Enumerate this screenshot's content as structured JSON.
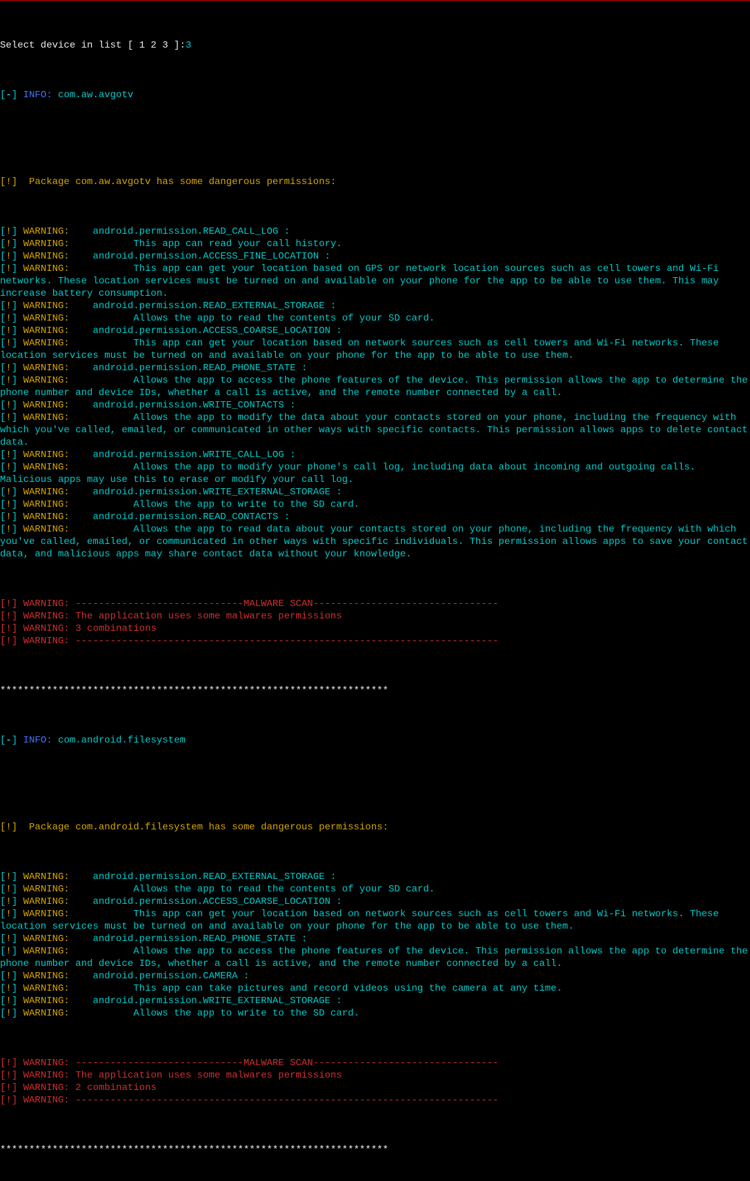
{
  "prompt_line": {
    "text": "Select device in list [ 1 2 3 ]:",
    "input": "3"
  },
  "info_prefix_open": "[",
  "info_prefix_dash": "-",
  "info_prefix_close": "] ",
  "info_label": "INFO:",
  "warn_prefix_open": "[",
  "warn_prefix_bang": "!",
  "warn_prefix_close": "] ",
  "warn_label": "WARNING:",
  "section_header_prefix": "[!]  ",
  "asterisks": "*******************************************************************",
  "pkg1": {
    "name": " com.aw.avgotv",
    "header": "Package com.aw.avgotv has some dangerous permissions: ",
    "warnings": [
      "   android.permission.READ_CALL_LOG :",
      "          This app can read your call history.",
      "   android.permission.ACCESS_FINE_LOCATION :",
      "          This app can get your location based on GPS or network location sources such as cell towers and Wi-Fi networks. These location services must be turned on and available on your phone for the app to be able to use them. This may increase battery consumption.",
      "   android.permission.READ_EXTERNAL_STORAGE :",
      "          Allows the app to read the contents of your SD card.",
      "   android.permission.ACCESS_COARSE_LOCATION :",
      "          This app can get your location based on network sources such as cell towers and Wi-Fi networks. These location services must be turned on and available on your phone for the app to be able to use them.",
      "   android.permission.READ_PHONE_STATE :",
      "          Allows the app to access the phone features of the device. This permission allows the app to determine the phone number and device IDs, whether a call is active, and the remote number connected by a call.",
      "   android.permission.WRITE_CONTACTS :",
      "          Allows the app to modify the data about your contacts stored on your phone, including the frequency with which you've called, emailed, or communicated in other ways with specific contacts. This permission allows apps to delete contact data.",
      "   android.permission.WRITE_CALL_LOG :",
      "          Allows the app to modify your phone's call log, including data about incoming and outgoing calls. Malicious apps may use this to erase or modify your call log.",
      "   android.permission.WRITE_EXTERNAL_STORAGE :",
      "          Allows the app to write to the SD card.",
      "   android.permission.READ_CONTACTS :",
      "          Allows the app to read data about your contacts stored on your phone, including the frequency with which you've called, emailed, or communicated in other ways with specific individuals. This permission allows apps to save your contact data, and malicious apps may share contact data without your knowledge."
    ],
    "malware": [
      "-----------------------------MALWARE SCAN--------------------------------",
      "The application uses some malwares permissions ",
      "3 combinations",
      "-------------------------------------------------------------------------"
    ]
  },
  "pkg2": {
    "name": " com.android.filesystem",
    "header": "Package com.android.filesystem has some dangerous permissions: ",
    "warnings": [
      "   android.permission.READ_EXTERNAL_STORAGE :",
      "          Allows the app to read the contents of your SD card.",
      "   android.permission.ACCESS_COARSE_LOCATION :",
      "          This app can get your location based on network sources such as cell towers and Wi-Fi networks. These location services must be turned on and available on your phone for the app to be able to use them.",
      "   android.permission.READ_PHONE_STATE :",
      "          Allows the app to access the phone features of the device. This permission allows the app to determine the phone number and device IDs, whether a call is active, and the remote number connected by a call.",
      "   android.permission.CAMERA :",
      "          This app can take pictures and record videos using the camera at any time.",
      "   android.permission.WRITE_EXTERNAL_STORAGE :",
      "          Allows the app to write to the SD card."
    ],
    "malware": [
      "-----------------------------MALWARE SCAN--------------------------------",
      "The application uses some malwares permissions ",
      "2 combinations",
      "-------------------------------------------------------------------------"
    ]
  }
}
